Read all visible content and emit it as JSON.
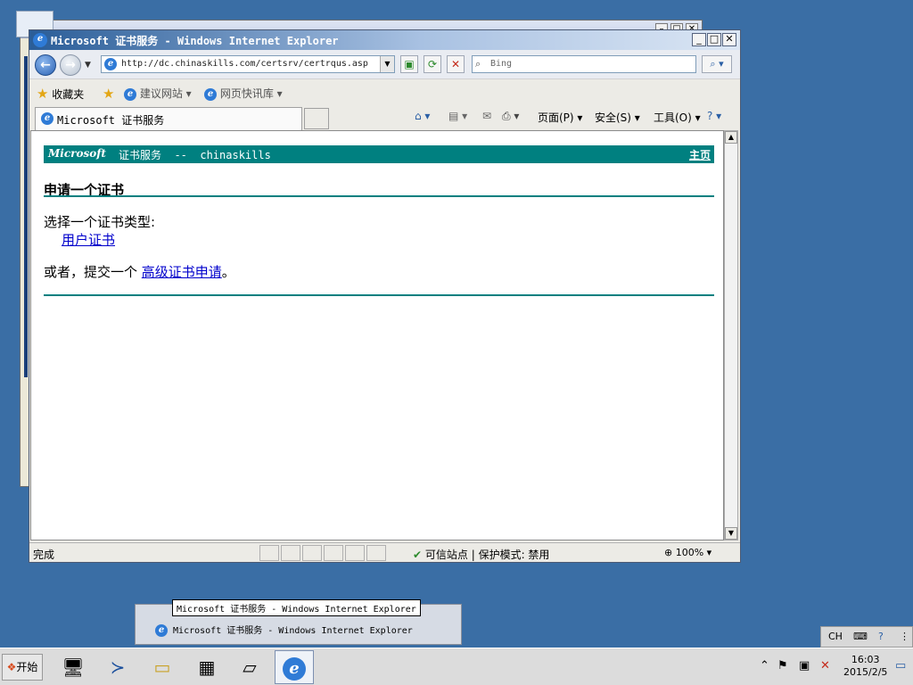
{
  "window": {
    "title": "Microsoft 证书服务 - Windows Internet Explorer"
  },
  "navbar": {
    "url": "http://dc.chinaskills.com/certsrv/certrqus.asp",
    "search_placeholder": "Bing"
  },
  "favorites_bar": {
    "favorites_label": "收藏夹",
    "suggested_sites": "建议网站",
    "web_slice_gallery": "网页快讯库"
  },
  "tab": {
    "label": "Microsoft 证书服务"
  },
  "commandbar": {
    "page": "页面(P)",
    "safety": "安全(S)",
    "tools": "工具(O)"
  },
  "page": {
    "header_brand": "Microsoft",
    "header_text": "证书服务  --  chinaskills",
    "home_link": "主页",
    "title": "申请一个证书",
    "select_label": "选择一个证书类型:",
    "user_cert_link": "用户证书",
    "or_prefix": "或者，提交一个 ",
    "advanced_link": "高级证书申请",
    "or_suffix": "。"
  },
  "statusbar": {
    "status": "完成",
    "zone": "可信站点 | 保护模式: 禁用",
    "zoom": "100%"
  },
  "taskbar": {
    "start_label": "开始",
    "tooltip": "Microsoft 证书服务 - Windows Internet Explorer",
    "preview_item": "Microsoft 证书服务 - Windows Internet Explorer",
    "time": "16:03",
    "date": "2015/2/5",
    "language": "CH"
  }
}
